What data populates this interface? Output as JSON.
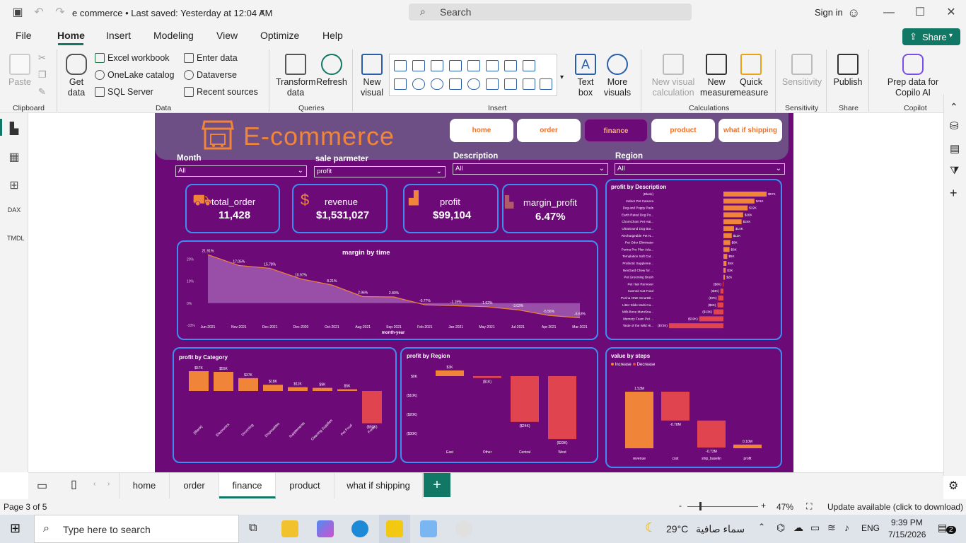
{
  "titlebar": {
    "doc_title": "e commerce • Last saved: Yesterday at 12:04 AM",
    "search": "Search",
    "signin": "Sign in"
  },
  "menu": {
    "tabs": [
      "File",
      "Home",
      "Insert",
      "Modeling",
      "View",
      "Optimize",
      "Help"
    ],
    "active": "Home",
    "share": "Share"
  },
  "ribbon": {
    "paste": "Paste",
    "get_data": "Get data",
    "excel": "Excel workbook",
    "onelake": "OneLake catalog",
    "sql": "SQL Server",
    "enter_data": "Enter data",
    "dataverse": "Dataverse",
    "recent": "Recent sources",
    "transform": "Transform data",
    "refresh": "Refresh",
    "new_visual": "New visual",
    "text_box": "Text box",
    "more_visuals": "More visuals",
    "new_visual_calc": "New visual calculation",
    "new_measure": "New measure",
    "quick_measure": "Quick measure",
    "sensitivity": "Sensitivity",
    "publish": "Publish",
    "copilot": "Prep data for Copilo AI",
    "groups": [
      "Clipboard",
      "Data",
      "Queries",
      "Insert",
      "Calculations",
      "Sensitivity",
      "Share",
      "Copilot"
    ]
  },
  "report": {
    "logo": "E-commerce",
    "nav": [
      "home",
      "order",
      "finance",
      "product",
      "what if shipping"
    ],
    "nav_active": "finance",
    "slicers": [
      {
        "label": "Month",
        "value": "All"
      },
      {
        "label": "sale parmeter",
        "value": "profit"
      },
      {
        "label": "Description",
        "value": "All"
      },
      {
        "label": "Region",
        "value": "All"
      }
    ],
    "kpis": [
      {
        "title": "total_order",
        "value": "11,428",
        "icon": "cart-check-icon"
      },
      {
        "title": "revenue",
        "value": "$1,531,027",
        "icon": "money-hand-icon"
      },
      {
        "title": "profit",
        "value": "$99,104",
        "icon": "profit-chart-icon"
      },
      {
        "title": "margin_profit",
        "value": "6.47%",
        "icon": "margin-chart-icon"
      }
    ],
    "margin_title": "margin by time",
    "margin_xlabel": "month-year",
    "desc_title": "profit by Description",
    "cat_title": "profit by Category",
    "region_title": "profit by Region",
    "steps_title": "value by steps",
    "steps_legend": [
      "Increase",
      "Decrease"
    ]
  },
  "chart_data": [
    {
      "type": "area",
      "title": "margin by time",
      "xlabel": "month-year",
      "x": [
        "Jun-2021",
        "Nov-2021",
        "Dec-2021",
        "Dec-2020",
        "Oct-2021",
        "Aug-2021",
        "Sep-2021",
        "Feb-2021",
        "Jan-2021",
        "May-2021",
        "Jul-2021",
        "Apr-2021",
        "Mar-2021"
      ],
      "values": [
        21.91,
        17.05,
        15.78,
        10.97,
        8.21,
        2.96,
        2.8,
        -0.77,
        -1.15,
        -1.62,
        -3.03,
        -5.56,
        -6.63
      ],
      "labels": [
        "21.91%",
        "17.05%",
        "15.78%",
        "10.97%",
        "8.21%",
        "2.96%",
        "2.80%",
        "-0.77%",
        "-1.15%",
        "-1.62%",
        "-3.03%",
        "-5.56%",
        "-6.63%"
      ],
      "yticks": [
        "20%",
        "10%",
        "0%",
        "-10%"
      ],
      "ylim": [
        -10,
        22
      ]
    },
    {
      "type": "bar",
      "title": "profit by Description",
      "categories": [
        "(Blank)",
        "Indoor Pet Camera",
        "Dog and Puppy Pads",
        "Earth Rated Dog Po...",
        "ChomChom Pet Hai...",
        "UltraSound Dog Bar...",
        "Rechargeable Pet N...",
        "Pet Odor Eliminator",
        "Purina Pro Plan Adu...",
        "Templation Soft Cat...",
        "Probiotic Suppleme...",
        "NexGard Chew for ...",
        "Pet Grooming Brush",
        "Pet Hair Remover",
        "Canned Cat Food",
        "Purina ONE SmartBl...",
        "Litter Slide Multi-Ca...",
        "Milk-Bone MaroSna...",
        "Memory Foam Pet ...",
        "Taste of the Wild Hi..."
      ],
      "values": [
        57,
        41,
        32,
        26,
        24,
        14,
        11,
        9,
        8,
        5,
        4,
        3,
        2,
        -0.3,
        -4,
        -7,
        -8,
        -13,
        -32,
        -72
      ],
      "labels": [
        "$57K",
        "$41K",
        "$32K",
        "$26K",
        "$24K",
        "$14K",
        "$11K",
        "$9K",
        "$8K",
        "$5K",
        "$4K",
        "$3K",
        "$2K",
        "($0K)",
        "($4K)",
        "($7K)",
        "($8K)",
        "($13K)",
        "($32K)",
        "($72K)"
      ]
    },
    {
      "type": "bar",
      "title": "profit by Category",
      "categories": [
        "(Blank)",
        "Electronics",
        "Grooming",
        "Disposables",
        "Supplements",
        "Cleaning Supplies",
        "Pet Food",
        "Food"
      ],
      "values": [
        57,
        55,
        37,
        18,
        11,
        9,
        5,
        -93
      ],
      "labels": [
        "$57K",
        "$55K",
        "$37K",
        "$18K",
        "$11K",
        "$9K",
        "$5K",
        "($93K)"
      ]
    },
    {
      "type": "bar",
      "title": "profit by Region",
      "categories": [
        "East",
        "Other",
        "Central",
        "West"
      ],
      "values": [
        3,
        -1,
        -24,
        -33
      ],
      "labels": [
        "$3K",
        "($1K)",
        "($24K)",
        "($33K)"
      ],
      "yticks": [
        "$0K",
        "($10K)",
        "($20K)",
        "($30K)"
      ]
    },
    {
      "type": "bar",
      "title": "value by steps",
      "categories": [
        "revenue",
        "cost",
        "ship_baselin",
        "profit"
      ],
      "values": [
        1.53,
        -0.78,
        -0.73,
        0.1
      ],
      "labels": [
        "1.53M",
        "-0.78M",
        "-0.73M",
        "0.10M"
      ],
      "legend": [
        "Increase",
        "Decrease"
      ]
    }
  ],
  "pages": {
    "tabs": [
      "home",
      "order",
      "finance",
      "product",
      "what if shipping"
    ],
    "active": "finance"
  },
  "status": {
    "page": "Page 3 of 5",
    "zoom": "47%",
    "update": "Update available (click to download)"
  },
  "taskbar": {
    "search": "Type here to search",
    "weather": "29°C",
    "weather_text": "سماء صافية",
    "lang": "ENG",
    "time": "9:39 PM",
    "date": "7/15/2026",
    "notif": "2"
  },
  "colors": {
    "accent": "#117865",
    "report_bg": "#6c0a78",
    "orange": "#f0853a",
    "bar_red": "#e0454f",
    "card_border": "#3d8ef0"
  }
}
